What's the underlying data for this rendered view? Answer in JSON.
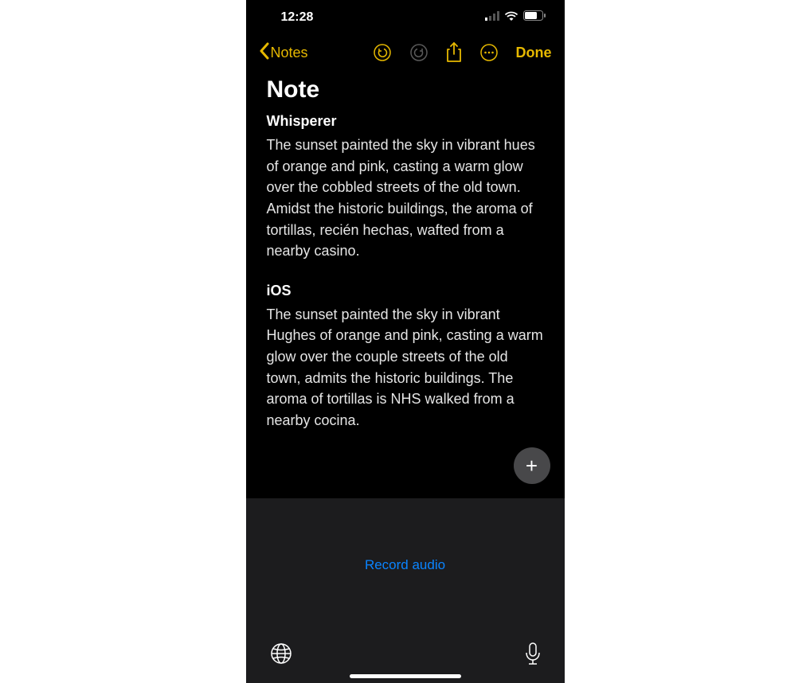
{
  "status": {
    "time": "12:28"
  },
  "nav": {
    "back_label": "Notes",
    "done_label": "Done"
  },
  "note": {
    "title": "Note",
    "section1": {
      "heading": "Whisperer",
      "body": "The sunset painted the sky in vibrant hues of orange and pink, casting a warm glow over the cobbled streets of the old town. Amidst the historic buildings, the aroma of tortillas, recién hechas, wafted from a nearby casino."
    },
    "section2": {
      "heading": "iOS",
      "body": "The sunset painted the sky in vibrant Hughes of orange and pink, casting a warm glow over the couple streets of the old town, admits the historic buildings. The aroma of tortillas is NHS walked from a nearby cocina."
    }
  },
  "keyboard": {
    "record_label": "Record audio"
  }
}
